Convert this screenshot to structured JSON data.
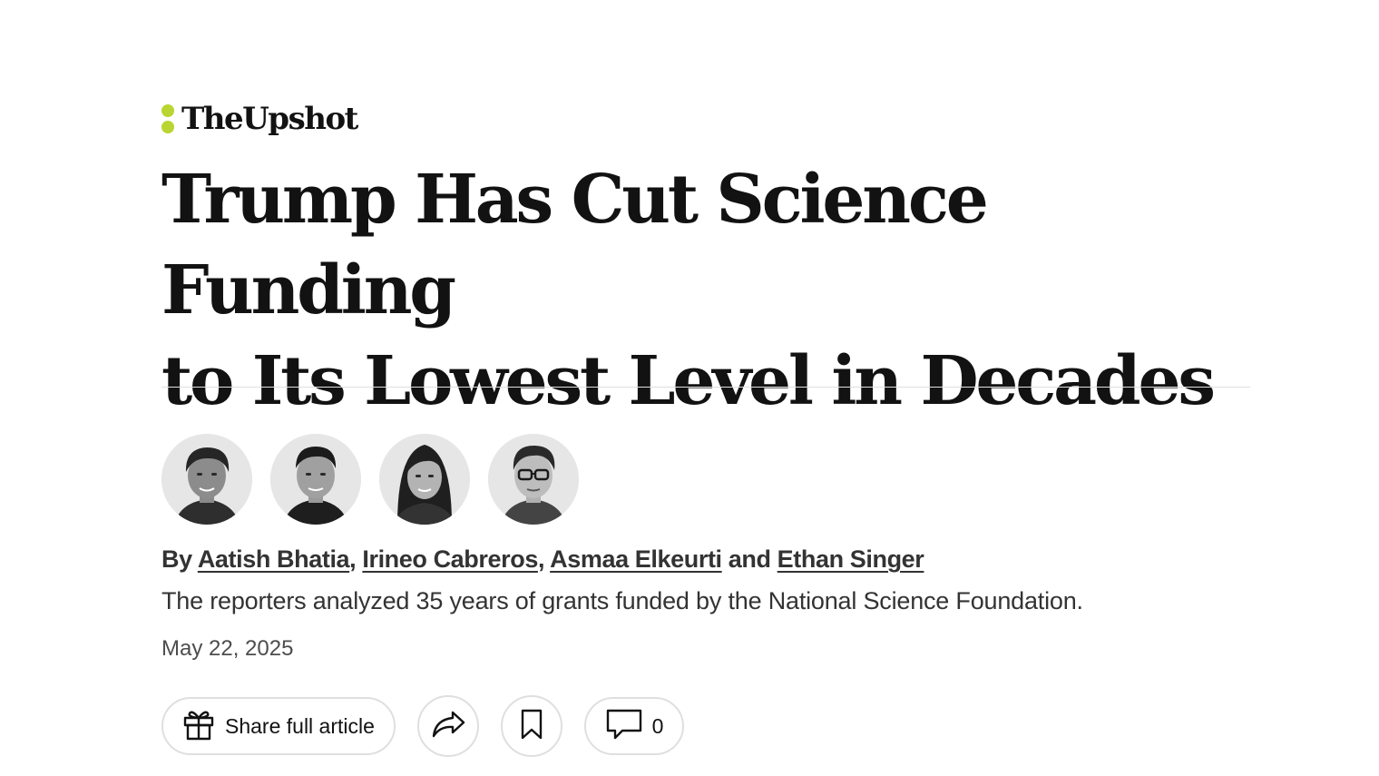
{
  "kicker": {
    "label": "TheUpshot",
    "dot_color": "#b9d531"
  },
  "headline": {
    "line1": "Trump Has Cut Science Funding",
    "line2": "to Its Lowest Level in Decades"
  },
  "byline": {
    "prefix": "By",
    "authors": [
      "Aatish Bhatia",
      "Irineo Cabreros",
      "Asmaa Elkeurti",
      "Ethan Singer"
    ],
    "separator": ", ",
    "conjunction": "and"
  },
  "summary": "The reporters analyzed 35 years of grants funded by the National Science Foundation.",
  "date": "May 22, 2025",
  "actions": {
    "share_full_article_label": "Share full article",
    "comment_count": "0",
    "icons": {
      "gift": "gift-icon",
      "share": "share-arrow-icon",
      "save": "bookmark-icon",
      "comments": "comment-bubble-icon"
    }
  }
}
